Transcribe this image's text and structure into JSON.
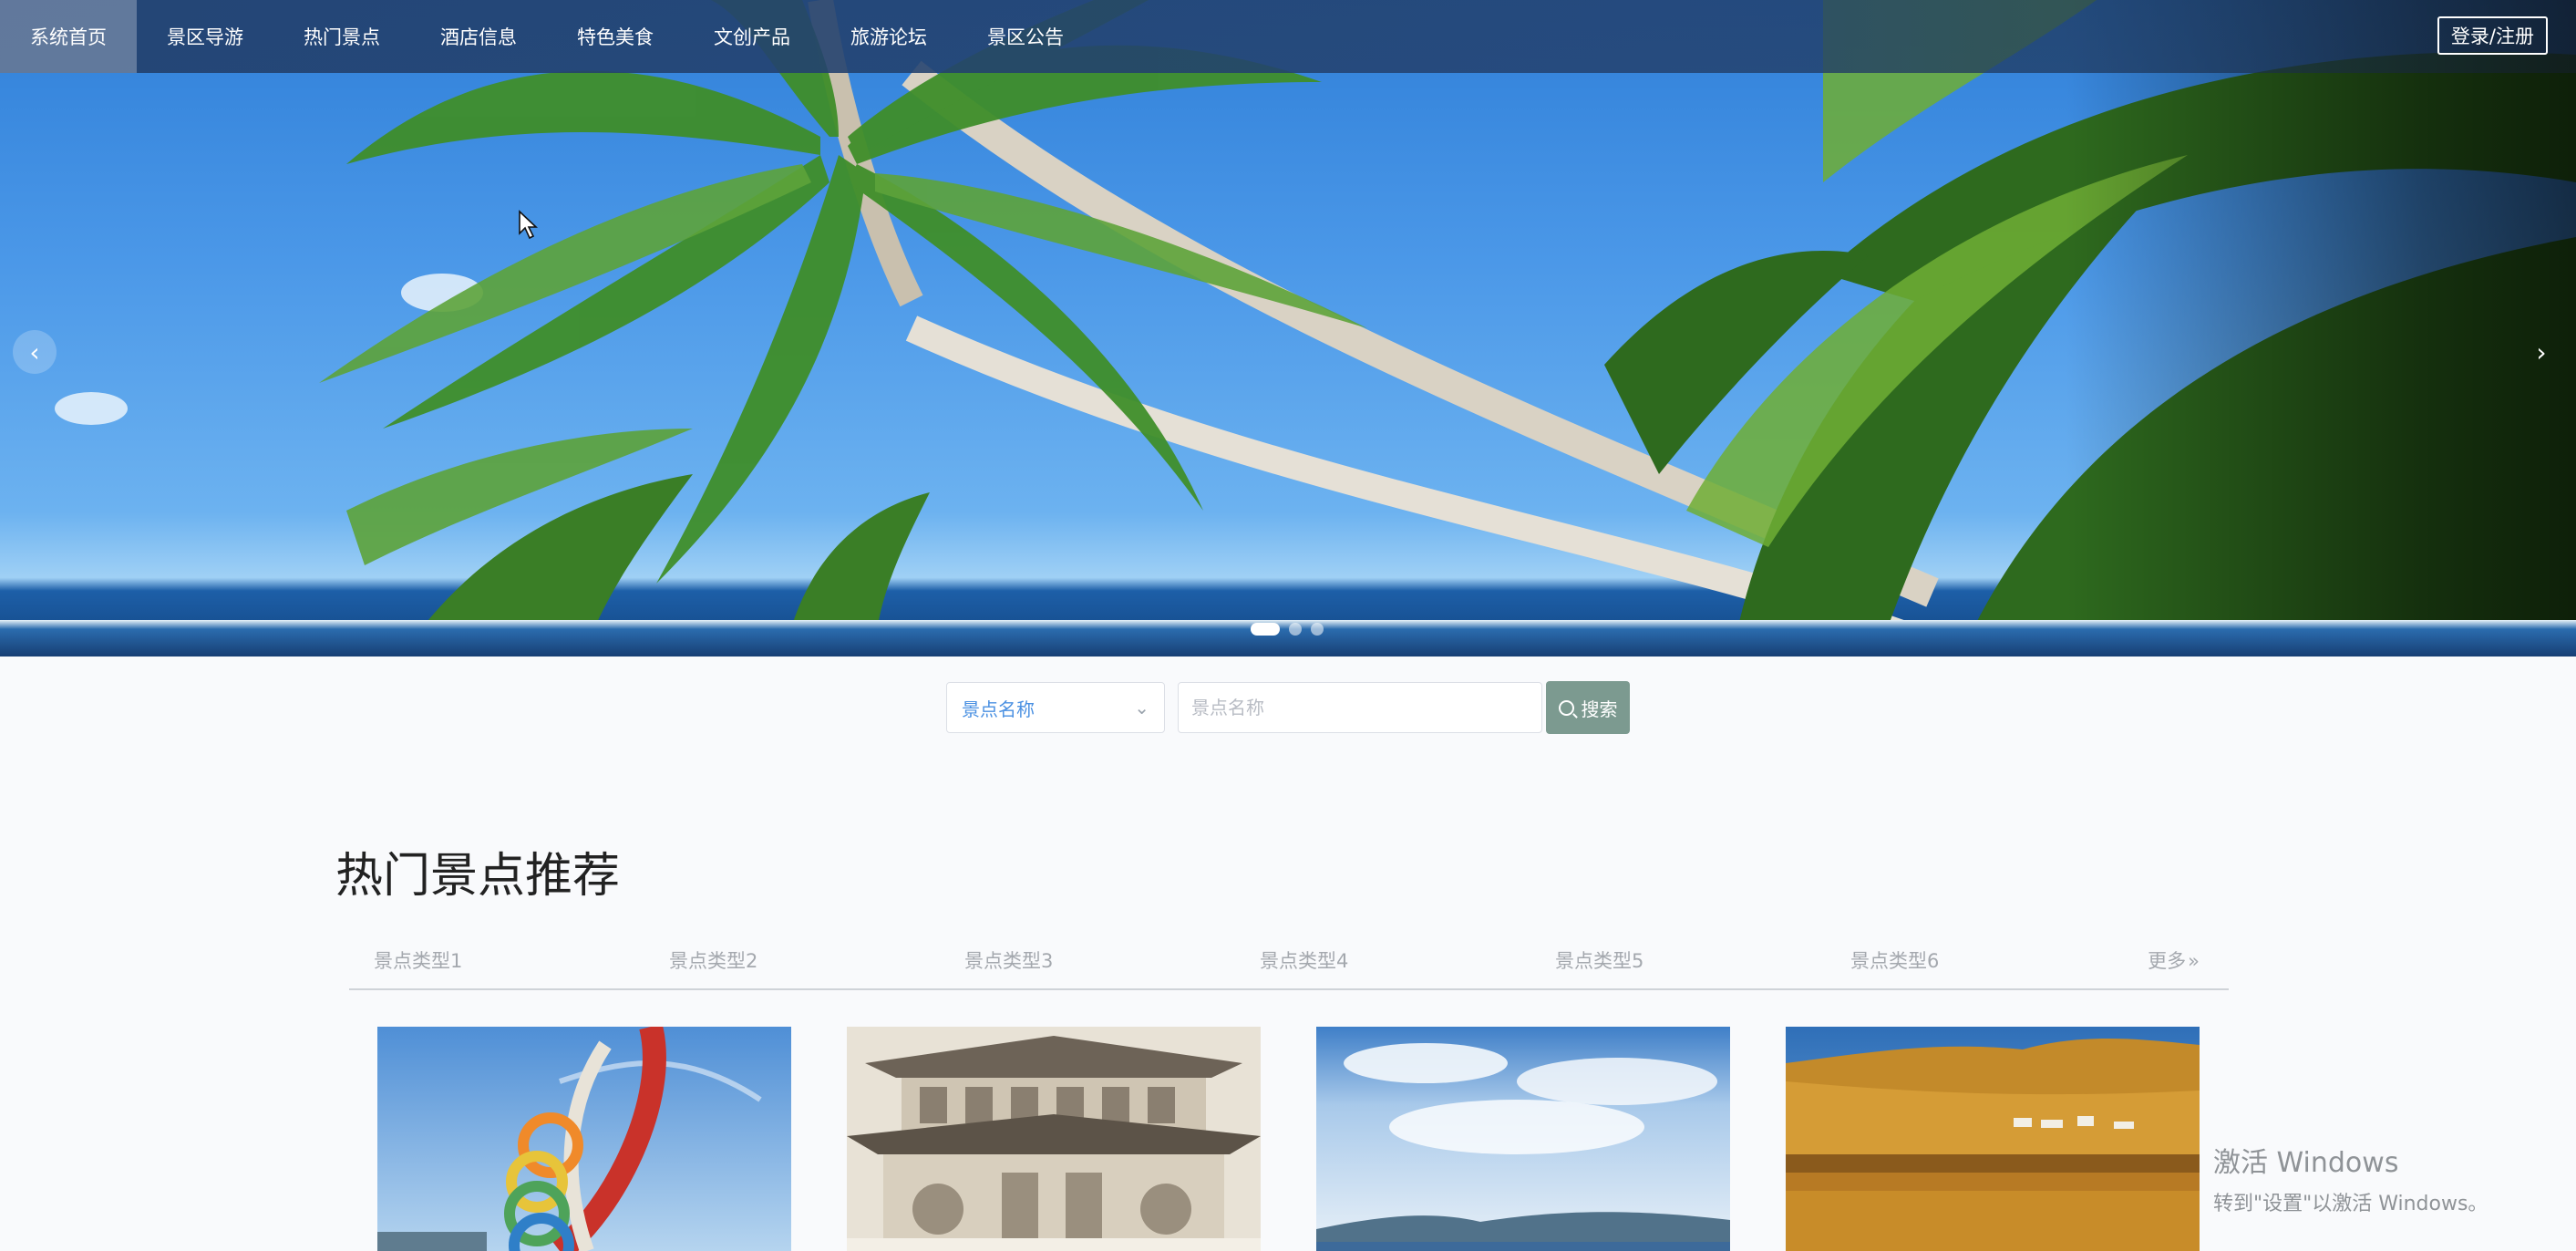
{
  "nav": {
    "items": [
      {
        "label": "系统首页",
        "active": true
      },
      {
        "label": "景区导游"
      },
      {
        "label": "热门景点"
      },
      {
        "label": "酒店信息"
      },
      {
        "label": "特色美食"
      },
      {
        "label": "文创产品"
      },
      {
        "label": "旅游论坛"
      },
      {
        "label": "景区公告"
      }
    ],
    "login_label": "登录/注册"
  },
  "carousel": {
    "prev_icon": "‹",
    "next_icon": "›",
    "slide_count": 3,
    "active_index": 0
  },
  "search": {
    "select_value": "景点名称",
    "input_placeholder": "景点名称",
    "button_label": "搜索",
    "button_color": "#7c9a90"
  },
  "section": {
    "title": "热门景点推荐",
    "types": [
      "景点类型1",
      "景点类型2",
      "景点类型3",
      "景点类型4",
      "景点类型5",
      "景点类型6"
    ],
    "more_label": "更多",
    "more_icon": "»"
  },
  "cards": [
    {
      "image": "colorful-ring-sculpture"
    },
    {
      "image": "ancient-pavilion"
    },
    {
      "image": "lake-and-mountains"
    },
    {
      "image": "golden-grassland-lake"
    }
  ],
  "watermark": {
    "line1": "激活 Windows",
    "line2": "转到\"设置\"以激活 Windows。"
  }
}
